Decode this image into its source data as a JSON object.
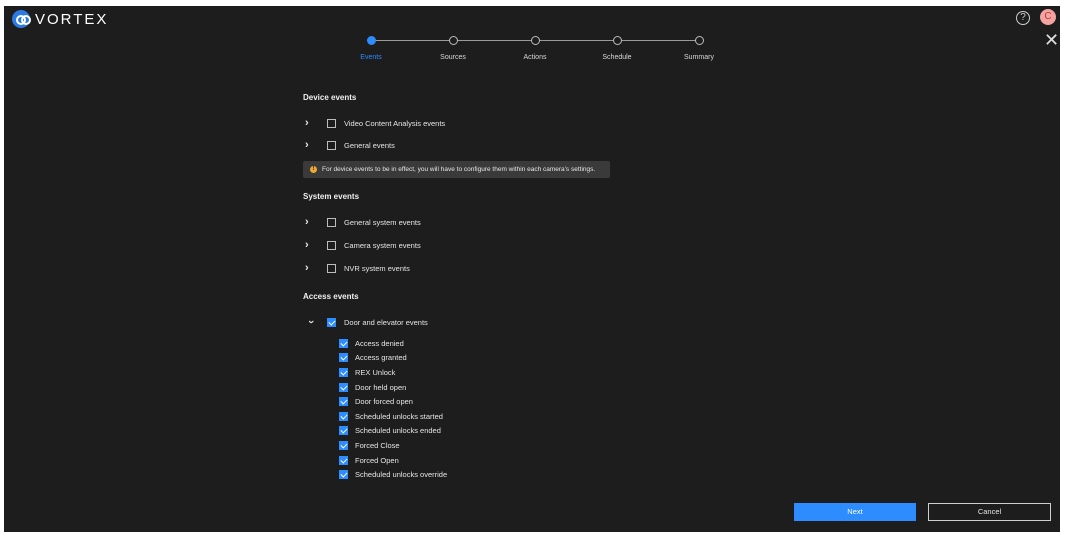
{
  "app": {
    "logo_text": "VORTEX",
    "avatar_initial": "C",
    "help_symbol": "?",
    "close_symbol": "✕"
  },
  "stepper": {
    "steps": [
      {
        "label": "Events",
        "active": true
      },
      {
        "label": "Sources",
        "active": false
      },
      {
        "label": "Actions",
        "active": false
      },
      {
        "label": "Schedule",
        "active": false
      },
      {
        "label": "Summary",
        "active": false
      }
    ]
  },
  "device_events": {
    "title": "Device events",
    "items": [
      {
        "label": "Video Content Analysis events",
        "checked": false
      },
      {
        "label": "General events",
        "checked": false
      }
    ],
    "notice": "For device events to be in effect, you will have to configure them within each camera's settings."
  },
  "system_events": {
    "title": "System events",
    "items": [
      {
        "label": "General system events",
        "checked": false
      },
      {
        "label": "Camera system events",
        "checked": false
      },
      {
        "label": "NVR system events",
        "checked": false
      }
    ]
  },
  "access_events": {
    "title": "Access events",
    "group": {
      "label": "Door and elevator events",
      "checked": true,
      "expanded": true
    },
    "sub_items": [
      "Access denied",
      "Access granted",
      "REX Unlock",
      "Door held open",
      "Door forced open",
      "Scheduled unlocks started",
      "Scheduled unlocks ended",
      "Forced Close",
      "Forced Open",
      "Scheduled unlocks override"
    ]
  },
  "footer": {
    "next_label": "Next",
    "cancel_label": "Cancel"
  },
  "colors": {
    "accent": "#2d8cff",
    "background": "#1d1d1d",
    "warning": "#f0a830"
  }
}
